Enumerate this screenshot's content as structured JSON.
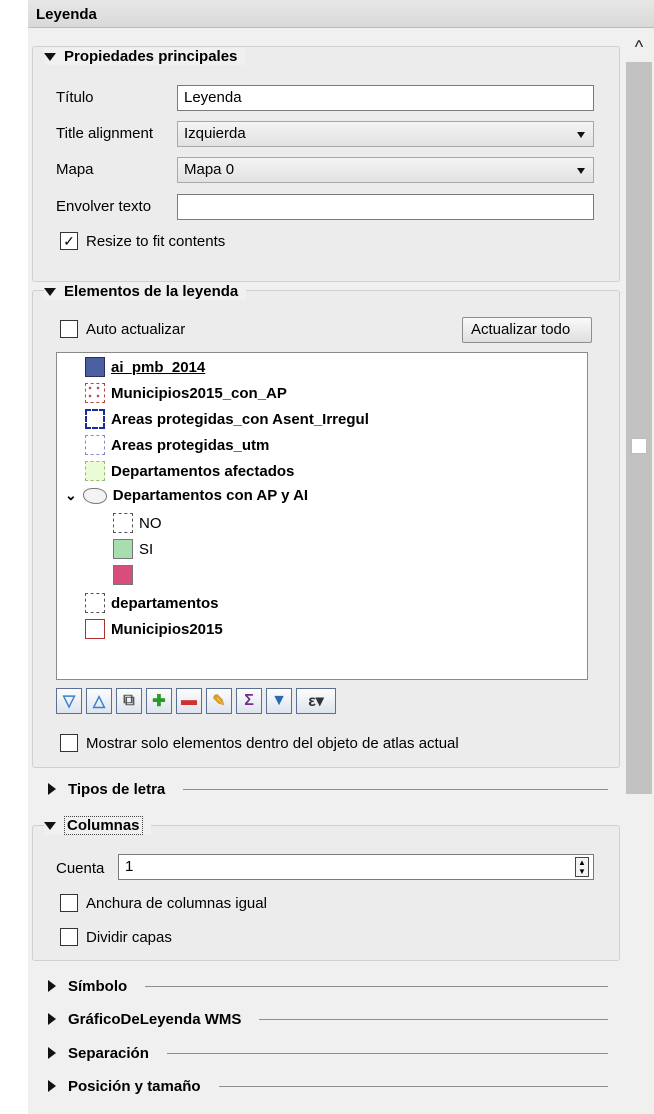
{
  "panel": {
    "title": "Leyenda"
  },
  "props": {
    "header": "Propiedades principales",
    "titulo_label": "Título",
    "titulo_value": "Leyenda",
    "align_label": "Title alignment",
    "align_value": "Izquierda",
    "mapa_label": "Mapa",
    "mapa_value": "Mapa 0",
    "wrap_label": "Envolver texto",
    "wrap_value": "",
    "resize_label": "Resize to fit contents",
    "resize_checked": true
  },
  "elements": {
    "header": "Elementos de la leyenda",
    "auto_label": "Auto actualizar",
    "update_all": "Actualizar todo",
    "items": [
      {
        "label": "ai_pmb_2014",
        "underline": true
      },
      {
        "label": "Municipios2015_con_AP"
      },
      {
        "label": "Areas protegidas_con Asent_Irregul"
      },
      {
        "label": "Areas protegidas_utm"
      },
      {
        "label": "Departamentos afectados"
      },
      {
        "label": "Departamentos con AP y AI"
      },
      {
        "label": "NO"
      },
      {
        "label": "SI"
      },
      {
        "label": ""
      },
      {
        "label": "departamentos"
      },
      {
        "label": "Municipios2015"
      }
    ],
    "atlas_label": "Mostrar solo elementos dentro del objeto de atlas actual"
  },
  "sections": {
    "tipos_letra": "Tipos de letra",
    "columnas": "Columnas",
    "simbolo": "Símbolo",
    "wms": "GráficoDeLeyenda WMS",
    "separacion": "Separación",
    "posicion": "Posición y tamaño"
  },
  "columnas": {
    "cuenta_label": "Cuenta",
    "cuenta_value": "1",
    "equal_label": "Anchura de columnas igual",
    "split_label": "Dividir capas"
  },
  "colors": {
    "ai_pmb_fill": "#4a5fa0",
    "municipios_ap_border": "#b04a4a",
    "areas_asent_border": "#1a2a9a",
    "areas_utm_border": "#8a8ac8",
    "dept_afectados_fill": "#eafbd6",
    "si_fill": "#a8ddb0",
    "unnamed_fill": "#d84d7a",
    "municipios2015_border": "#b03030"
  }
}
